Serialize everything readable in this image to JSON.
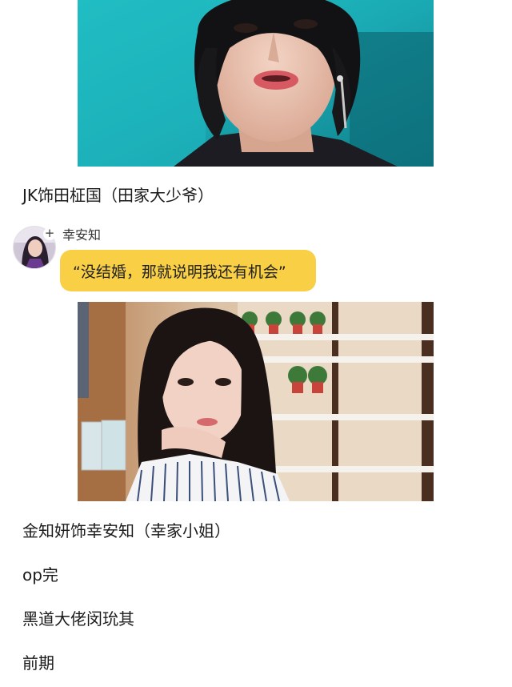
{
  "post": {
    "caption_jk": "JK饰田柾国（田家大少爷）",
    "chat": {
      "speaker": "幸安知",
      "message": "“没结婚，那就说明我还有机会”",
      "plus_symbol": "+"
    },
    "caption_kim": "金知妍饰幸安知（幸家小姐）",
    "line_op": "op完",
    "line_gang": "黑道大佬闵玧其",
    "line_early": "前期"
  },
  "colors": {
    "bubble": "#f8cf45",
    "text": "#1a1a1a",
    "background": "#ffffff"
  },
  "images": {
    "top": "man-closeup-photo",
    "middle": "woman-portrait-photo",
    "avatar": "woman-avatar-photo"
  }
}
